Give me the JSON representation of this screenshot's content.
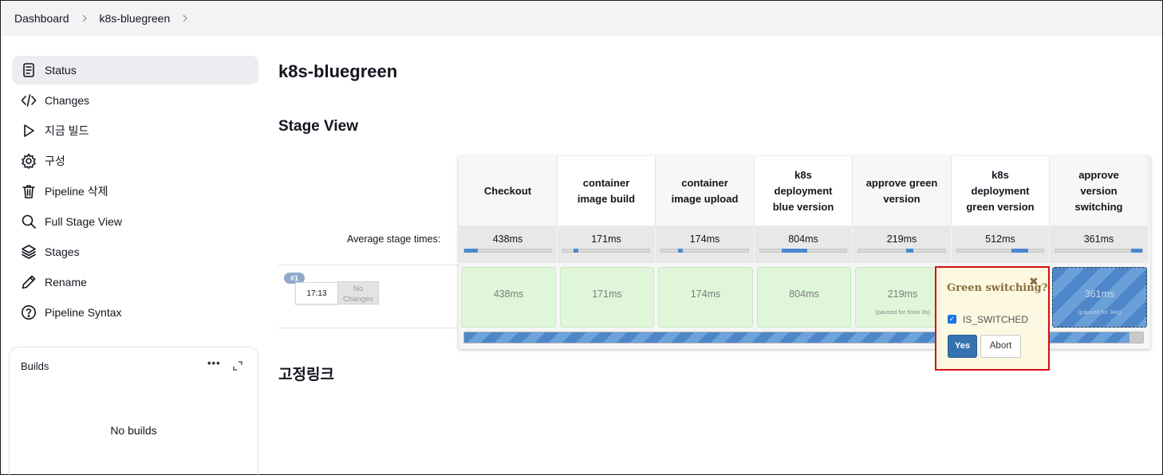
{
  "breadcrumb": {
    "items": [
      "Dashboard",
      "k8s-bluegreen"
    ]
  },
  "sidebar": {
    "items": [
      {
        "label": "Status",
        "icon": "document-icon"
      },
      {
        "label": "Changes",
        "icon": "code-icon"
      },
      {
        "label": "지금 빌드",
        "icon": "play-icon"
      },
      {
        "label": "구성",
        "icon": "gear-icon"
      },
      {
        "label": "Pipeline 삭제",
        "icon": "trash-icon"
      },
      {
        "label": "Full Stage View",
        "icon": "search-icon"
      },
      {
        "label": "Stages",
        "icon": "layers-icon"
      },
      {
        "label": "Rename",
        "icon": "pencil-icon"
      },
      {
        "label": "Pipeline Syntax",
        "icon": "help-icon"
      }
    ]
  },
  "builds": {
    "title": "Builds",
    "more": "•••",
    "empty": "No builds"
  },
  "main": {
    "title": "k8s-bluegreen",
    "stage_view_heading": "Stage View",
    "permalinks_heading": "고정링크"
  },
  "stage_view": {
    "average_label": "Average stage times:",
    "stages": [
      {
        "name": "Checkout",
        "avg": "438ms",
        "avg_fraction": 0.16,
        "avg_offset": 0.0
      },
      {
        "name": "container image build",
        "avg": "171ms",
        "avg_fraction": 0.06,
        "avg_offset": 0.12
      },
      {
        "name": "container image upload",
        "avg": "174ms",
        "avg_fraction": 0.06,
        "avg_offset": 0.19
      },
      {
        "name": "k8s deployment blue version",
        "avg": "804ms",
        "avg_fraction": 0.3,
        "avg_offset": 0.25
      },
      {
        "name": "approve green version",
        "avg": "219ms",
        "avg_fraction": 0.08,
        "avg_offset": 0.55
      },
      {
        "name": "k8s deployment green version",
        "avg": "512ms",
        "avg_fraction": 0.19,
        "avg_offset": 0.63
      },
      {
        "name": "approve version switching",
        "avg": "361ms",
        "avg_fraction": 0.13,
        "avg_offset": 0.87
      }
    ],
    "run": {
      "number": "#1",
      "time": "17:13",
      "changes": "No Changes",
      "cells": [
        {
          "duration": "438ms",
          "note": "",
          "state": "success"
        },
        {
          "duration": "171ms",
          "note": "",
          "state": "success"
        },
        {
          "duration": "174ms",
          "note": "",
          "state": "success"
        },
        {
          "duration": "804ms",
          "note": "",
          "state": "success"
        },
        {
          "duration": "219ms",
          "note": "(paused for 5min 0s)",
          "state": "success"
        },
        {
          "duration": "",
          "note": "",
          "state": "success"
        },
        {
          "duration": "361ms",
          "note": "(paused for 34s)",
          "state": "paused"
        }
      ],
      "progress_fraction": 0.98
    }
  },
  "input_prompt": {
    "title": "Green switching?",
    "close": "✖",
    "param_label": "IS_SWITCHED",
    "param_checked": true,
    "yes_label": "Yes",
    "abort_label": "Abort"
  },
  "colors": {
    "success_cell": "#dff6d9",
    "paused_cell": "#4d87c9",
    "popover_border": "#d40f0f",
    "yes_button": "#3572b0"
  }
}
